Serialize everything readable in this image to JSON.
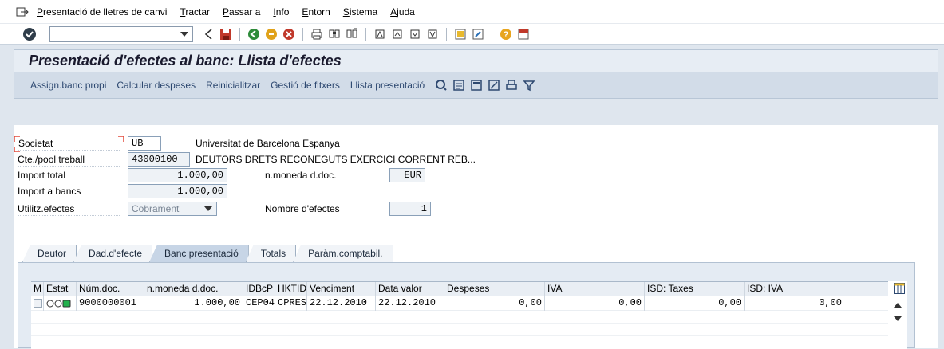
{
  "menubar": {
    "items": [
      "Presentació de lletres de canvi",
      "Tractar",
      "Passar a",
      "Info",
      "Entorn",
      "Sistema",
      "Ajuda"
    ]
  },
  "toolbar": {
    "command_field_value": ""
  },
  "title": "Presentació d'efectes al banc: Llista d'efectes",
  "app_toolbar": {
    "buttons": [
      "Assign.banc propi",
      "Calcular despeses",
      "Reinicialitzar",
      "Gestió de fitxers",
      "Llista presentació"
    ]
  },
  "form": {
    "societat": {
      "label": "Societat",
      "value": "UB",
      "text": "Universitat de Barcelona Espanya"
    },
    "cte_pool": {
      "label": "Cte./pool treball",
      "value": "43000100",
      "text": "DEUTORS DRETS RECONEGUTS EXERCICI CORRENT REB..."
    },
    "import_total": {
      "label": "Import total",
      "value": "1.000,00"
    },
    "moneda": {
      "label": "n.moneda d.doc.",
      "value": "EUR"
    },
    "import_bancs": {
      "label": "Import a bancs",
      "value": "1.000,00"
    },
    "utilitz": {
      "label": "Utilitz.efectes",
      "value": "Cobrament"
    },
    "nombre": {
      "label": "Nombre d'efectes",
      "value": "1"
    }
  },
  "tabs": [
    "Deutor",
    "Dad.d'efecte",
    "Banc presentació",
    "Totals",
    "Paràm.comptabil."
  ],
  "active_tab": "Banc presentació",
  "table": {
    "columns": [
      "M",
      "Estat",
      "Núm.doc.",
      "n.moneda d.doc.",
      "IDBcP",
      "HKTID",
      "Venciment",
      "Data valor",
      "Despeses",
      "IVA",
      "ISD: Taxes",
      "ISD: IVA"
    ],
    "rows": [
      {
        "num_doc": "9000000001",
        "import": "1.000,00",
        "idbcp": "CEP04",
        "hktid": "CPRES",
        "venciment": "22.12.2010",
        "data_valor": "22.12.2010",
        "despeses": "0,00",
        "iva": "0,00",
        "isd_taxes": "0,00",
        "isd_iva": "0,00",
        "status_lights": [
          "empty",
          "empty",
          "green"
        ]
      }
    ]
  },
  "colors": {
    "title": "#1a1a2e",
    "app_button_text": "#2d4870",
    "status_green": "#22b14c",
    "active_tab": "#c7d5e6"
  }
}
